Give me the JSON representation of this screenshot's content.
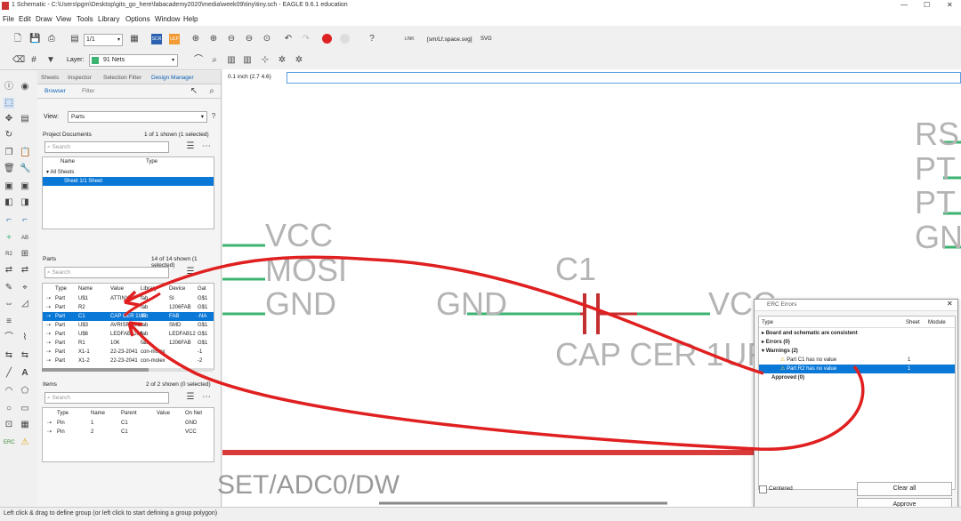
{
  "window": {
    "title": "1 Schematic - C:\\Users\\pgm\\Desktop\\gits_go_here\\fabacademy2020\\media\\week09\\tiny\\tiny.sch - EAGLE 9.6.1 education"
  },
  "menu": [
    "File",
    "Edit",
    "Draw",
    "View",
    "Tools",
    "Library",
    "Options",
    "Window",
    "Help"
  ],
  "toolbar": {
    "sheet": "1/1",
    "cmd_coord": "0.1 inch (2.7 4.6)",
    "file_label": "[sm/Lf.space.svg]",
    "svg_label": "SVG",
    "layer": "91 Nets"
  },
  "left_tabs": [
    "Sheets",
    "Inspector",
    "Selection Filter",
    "Design Manager"
  ],
  "sub_tabs": [
    "Browser",
    "Filter"
  ],
  "view": {
    "label": "View:",
    "value": "Parts"
  },
  "project": {
    "title": "Project Documents",
    "count": "1 of 1 shown (1 selected)",
    "search": "Search",
    "col_name": "Name",
    "col_type": "Type",
    "group": "All Sheets",
    "item": "Sheet 1/1  Sheet"
  },
  "parts": {
    "title": "Parts",
    "count": "14 of 14 shown (1 selected)",
    "search": "Search",
    "headers": [
      "Type",
      "Name",
      "Value",
      "Library",
      "Device",
      "Gat"
    ],
    "rows": [
      [
        "Part",
        "U$1",
        "ATTINY44",
        "fab",
        "SI",
        "G$1"
      ],
      [
        "Part",
        "R2",
        "",
        "fab",
        "1206FAB",
        "G$1"
      ],
      [
        "Part",
        "C1",
        "CAP CER 1UF",
        "fab",
        "FAB",
        "-NA"
      ],
      [
        "Part",
        "U$3",
        "AVRISPSMD",
        "fab",
        "SMD",
        "G$1"
      ],
      [
        "Part",
        "U$6",
        "LEDFAB1206",
        "fab",
        "LEDFAB12",
        "G$1"
      ],
      [
        "Part",
        "R1",
        "10K",
        "fab",
        "1206FAB",
        "G$1"
      ],
      [
        "Part",
        "X1-1",
        "22-23-2041",
        "con-molex",
        "",
        "-1"
      ],
      [
        "Part",
        "X1-2",
        "22-23-2041",
        "con-molex",
        "",
        "-2"
      ]
    ]
  },
  "items": {
    "title": "Items",
    "count": "2 of 2 shown (0 selected)",
    "search": "Search",
    "headers": [
      "Type",
      "Name",
      "Parent",
      "Value",
      "On Net"
    ],
    "rows": [
      [
        "Pin",
        "1",
        "C1",
        "",
        "GND"
      ],
      [
        "Pin",
        "2",
        "C1",
        "",
        "VCC"
      ]
    ]
  },
  "schematic": {
    "vcc": "VCC",
    "mosi": "MOSI",
    "gnd_left": "GND",
    "c1": "C1",
    "gnd_mid": "GND",
    "vcc_mid": "VCC",
    "cap": "CAP CER 1UF",
    "bottom": "SET/ADC0/DW",
    "r1": "RS",
    "r2": "PT",
    "r3": "PT",
    "r4": "GN"
  },
  "erc": {
    "title": "ERC Errors",
    "col_type": "Type",
    "col_sheet": "Sheet",
    "col_module": "Module",
    "consistent": "Board and schematic are consistent",
    "errors": "Errors (0)",
    "warnings": "Warnings (2)",
    "w1": "Part C1 has no value",
    "w1_sheet": "1",
    "w2": "Part R2 has no value",
    "w2_sheet": "1",
    "approved": "Approved (0)",
    "centered": "Centered",
    "clear_all": "Clear all",
    "approve": "Approve"
  },
  "status": "Left click & drag to define group (or left click to start defining a group polygon)",
  "colors": {
    "accent": "#0a78d7",
    "net": "#3cb371",
    "annotation": "#e02020",
    "bus": "#d93a3a"
  }
}
